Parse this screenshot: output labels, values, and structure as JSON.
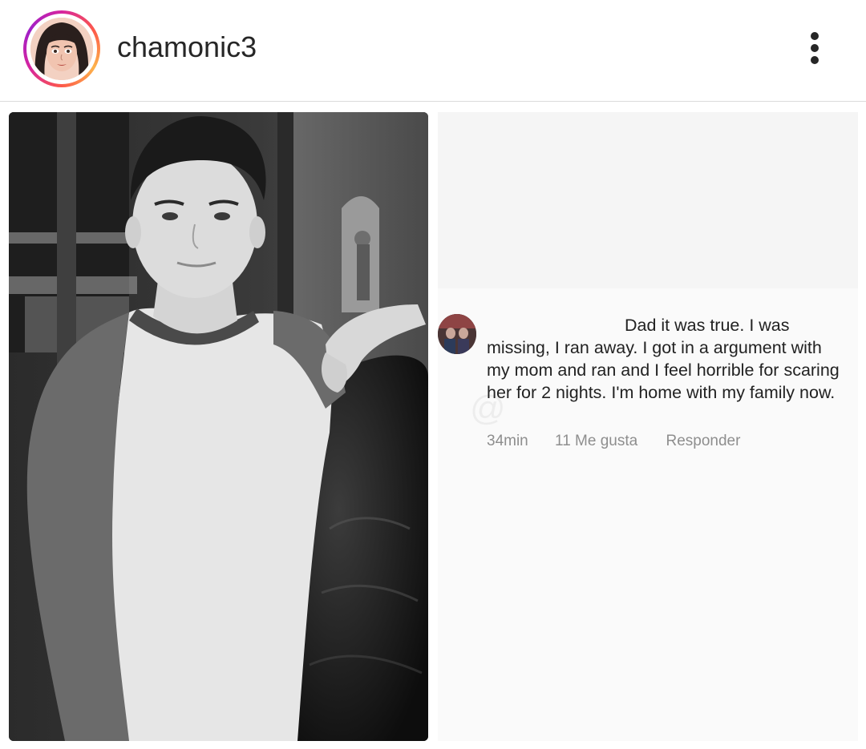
{
  "header": {
    "username": "chamonic3",
    "avatar_icon": "profile-avatar-illustration",
    "more_icon": "more-options-vertical-dots-icon",
    "ring_colors": [
      "#d6249f",
      "#fd5949",
      "#fdb34b"
    ]
  },
  "post": {
    "photo_description_icon": "post-photo",
    "comment": {
      "text": "Dad it was true. I was missing, I ran away. I got in a argument with my mom and ran and I feel horrible for scaring her for 2 nights. I'm home with my family now.",
      "time": "34min",
      "likes": "11 Me gusta",
      "reply": "Responder"
    }
  }
}
